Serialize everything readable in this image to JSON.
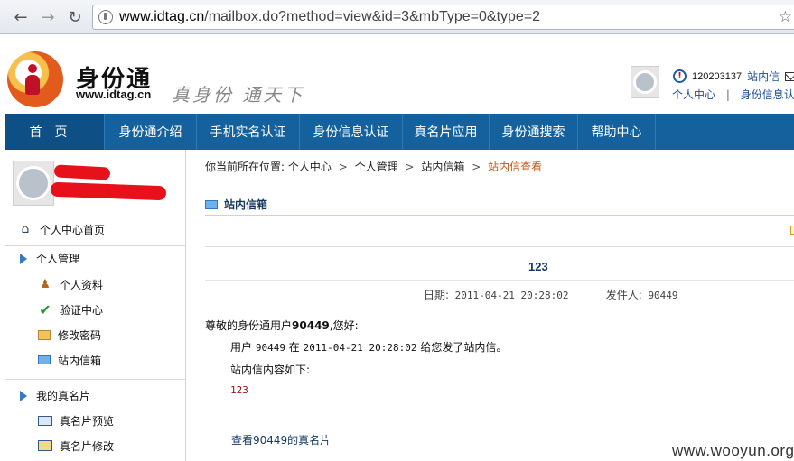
{
  "browser": {
    "url_host": "www.idtag.cn",
    "url_path": "/mailbox.do?method=view&id=3&mbType=0&type=2"
  },
  "header": {
    "logo_text": "身份通",
    "logo_url": "www.idtag.cn",
    "slogan": "真身份 通天下",
    "user_id": "120203137",
    "mail_link": "站内信",
    "link_personal": "个人中心",
    "link_sep": "|",
    "link_identity": "身份信息认证"
  },
  "nav": {
    "items": [
      {
        "label": "首页",
        "width": 110
      },
      {
        "label": "身份通介绍",
        "width": 102
      },
      {
        "label": "手机实名认证",
        "width": 114
      },
      {
        "label": "身份信息认证",
        "width": 114
      },
      {
        "label": "真名片应用",
        "width": 96
      },
      {
        "label": "身份通搜索",
        "width": 98
      },
      {
        "label": "帮助中心",
        "width": 86
      }
    ]
  },
  "sidebar": {
    "home": "个人中心首页",
    "group1": "个人管理",
    "profile": "个人资料",
    "verify": "验证中心",
    "password": "修改密码",
    "inbox": "站内信箱",
    "group2": "我的真名片",
    "card_preview": "真名片预览",
    "card_edit": "真名片修改"
  },
  "content": {
    "breadcrumb_prefix": "你当前所在位置:",
    "bc1": "个人中心",
    "bc2": "个人管理",
    "bc3": "站内信箱",
    "bc4": "站内信查看",
    "arrow": ">",
    "section_title": "站内信箱",
    "msg_title": "123",
    "date_label": "日期:",
    "date_value": "2011-04-21 20:28:02",
    "sender_label": "发件人:",
    "sender_value": "90449",
    "greet_pre": "尊敬的身份通用户",
    "greet_user": "90449",
    "greet_post": ",您好:",
    "body_user_label": "用户",
    "body_user": "90449",
    "body_at": "在",
    "body_time": "2011-04-21 20:28:02",
    "body_tail": "给您发了站内信。",
    "body_content_label": "站内信内容如下:",
    "body_content": "123",
    "view_card": "查看90449的真名片"
  },
  "watermark": "www.wooyun.org"
}
